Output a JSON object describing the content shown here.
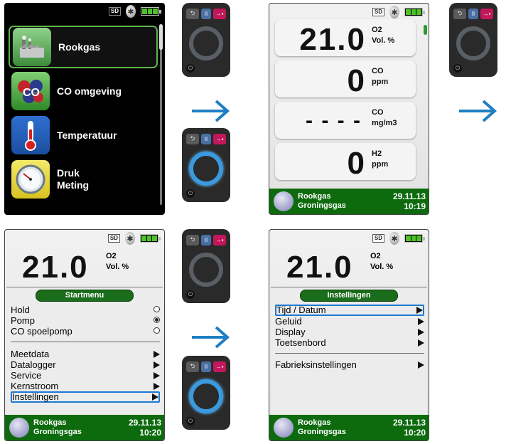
{
  "screen1": {
    "menu_items": [
      {
        "label": "Rookgas",
        "icon": "factory-icon"
      },
      {
        "label": "CO omgeving",
        "icon": "co-molecule-icon"
      },
      {
        "label": "Temperatuur",
        "icon": "thermometer-icon"
      },
      {
        "label": "Druk\nMeting",
        "icon": "pressure-gauge-icon"
      }
    ]
  },
  "status": {
    "sd": "SD"
  },
  "screen2": {
    "rows": [
      {
        "value": "21.0",
        "name": "O2",
        "unit": "Vol. %"
      },
      {
        "value": "0",
        "name": "CO",
        "unit": "ppm"
      },
      {
        "value": "- - - -",
        "name": "CO",
        "unit": "mg/m3"
      },
      {
        "value": "0",
        "name": "H2",
        "unit": "ppm"
      }
    ],
    "footer": {
      "line1": "Rookgas",
      "line2": "Groningsgas",
      "date": "29.11.13",
      "time": "10:19"
    }
  },
  "screen3": {
    "header_value": "21.0",
    "header_name": "O2",
    "header_unit": "Vol. %",
    "panel_title": "Startmenu",
    "items": [
      "Hold",
      "Pomp",
      "CO spoelpomp",
      "Meetdata",
      "Datalogger",
      "Service",
      "Kernstroom",
      "Instellingen"
    ],
    "footer": {
      "line1": "Rookgas",
      "line2": "Groningsgas",
      "date": "29.11.13",
      "time": "10:20"
    }
  },
  "screen4": {
    "header_value": "21.0",
    "header_name": "O2",
    "header_unit": "Vol. %",
    "panel_title": "Instellingen",
    "items": [
      "Tijd / Datum",
      "Geluid",
      "Display",
      "Toetsenbord",
      "Fabrieksinstellingen"
    ],
    "footer": {
      "line1": "Rookgas",
      "line2": "Groningsgas",
      "date": "29.11.13",
      "time": "10:20"
    }
  },
  "colors": {
    "accent_green": "#0d6b0d",
    "selection_blue": "#1e7ad2",
    "arrow_blue": "#1f7fc4",
    "active_dial": "#3a9ae0",
    "enter_key": "#c2185b"
  }
}
